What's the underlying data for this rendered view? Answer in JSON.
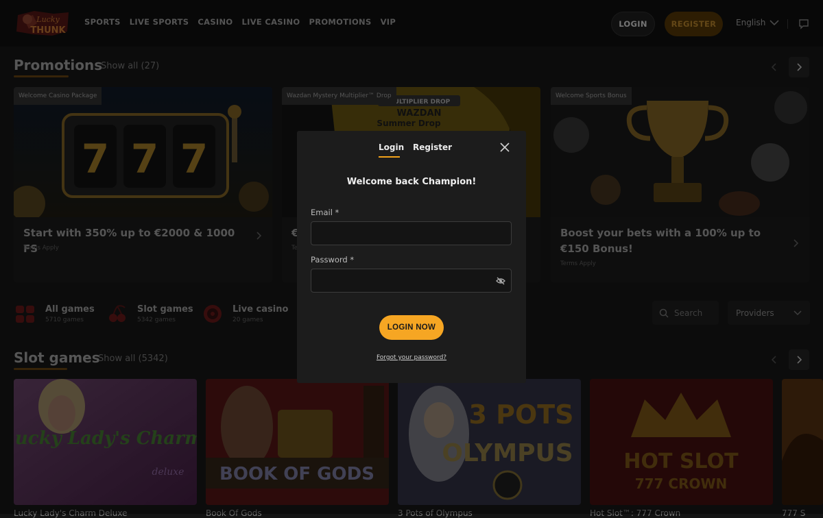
{
  "brand": {
    "logo_text_top": "Lucky",
    "logo_text_bottom": "THUNK"
  },
  "nav": [
    "SPORTS",
    "LIVE SPORTS",
    "CASINO",
    "LIVE CASINO",
    "PROMOTIONS",
    "VIP"
  ],
  "header": {
    "login_label": "LOGIN",
    "register_label": "REGISTER",
    "language": "English"
  },
  "promotions": {
    "title": "Promotions",
    "show_all": "Show all (27)",
    "cards": [
      {
        "tag": "Welcome Casino Package",
        "title": "Start with 350% up to €2000 & 1000 FS",
        "terms": "Terms Apply"
      },
      {
        "tag": "Wazdan Mystery Multiplier™ Drop",
        "title": "€",
        "terms": "Te",
        "art_line1": "MULTIPLIER DROP",
        "art_line2": "WAZDAN",
        "art_line3": "Summer Drop"
      },
      {
        "tag": "Welcome Sports Bonus",
        "title": "Boost your bets with a 100% up to €150 Bonus!",
        "terms": "Terms Apply"
      }
    ]
  },
  "categories": [
    {
      "name": "All games",
      "count": "5710 games",
      "icon": "grid-icon"
    },
    {
      "name": "Slot games",
      "count": "5342 games",
      "icon": "cherry-icon"
    },
    {
      "name": "Live casino",
      "count": "20 games",
      "icon": "roulette-icon"
    }
  ],
  "search": {
    "placeholder": "Search"
  },
  "providers": {
    "label": "Providers"
  },
  "slot_games": {
    "title": "Slot games",
    "show_all": "Show all (5342)",
    "games": [
      {
        "name": "Lucky Lady's Charm Deluxe",
        "art_text": "Lucky Lady's Charm",
        "art_sub": "deluxe"
      },
      {
        "name": "Book Of Gods",
        "art_text": "BOOK OF GODS"
      },
      {
        "name": "3 Pots of Olympus",
        "art_text": "3 POTS",
        "art_sub": "OLYMPUS"
      },
      {
        "name": "Hot Slot™: 777 Crown",
        "art_text": "HOT SLOT",
        "art_sub": "777 CROWN"
      },
      {
        "name": "777 S"
      }
    ]
  },
  "modal": {
    "tab_login": "Login",
    "tab_register": "Register",
    "title": "Welcome back Champion!",
    "email_label": "Email *",
    "email_value": "",
    "password_label": "Password *",
    "password_value": "",
    "submit_label": "LOGIN NOW",
    "forgot_label": "Forgot your password?"
  },
  "colors": {
    "accent": "#f6a623",
    "background": "#141414",
    "panel": "#1c1c1c"
  }
}
